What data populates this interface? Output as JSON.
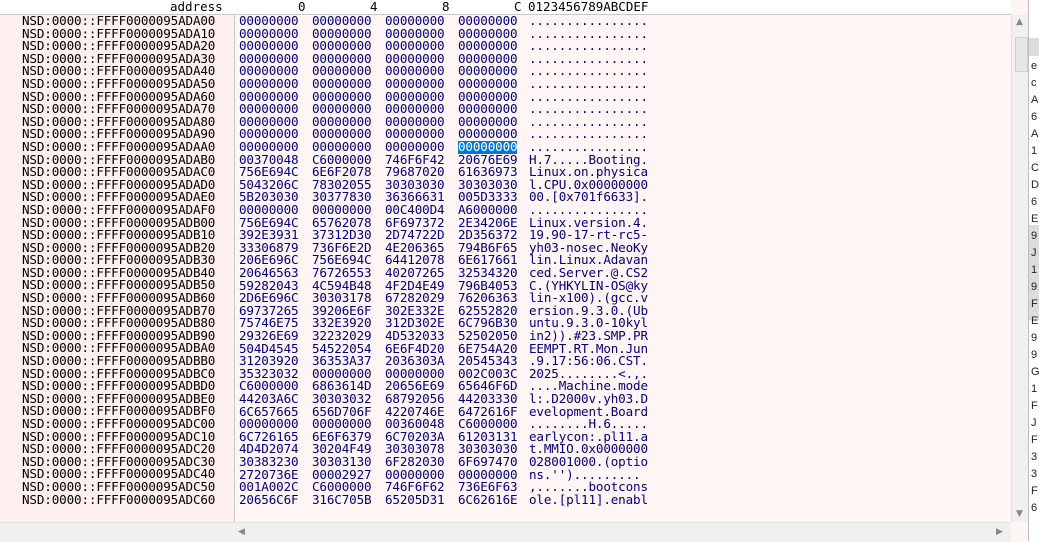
{
  "header": {
    "address": "address",
    "col0": "0",
    "col4": "4",
    "col8": "8",
    "colC": "C",
    "ascii": "0123456789ABCDEF"
  },
  "rows": [
    {
      "addr": "NSD:0000::FFFF0000095ADA00",
      "w": [
        "00000000",
        "00000000",
        "00000000",
        "00000000"
      ],
      "a": "................"
    },
    {
      "addr": "NSD:0000::FFFF0000095ADA10",
      "w": [
        "00000000",
        "00000000",
        "00000000",
        "00000000"
      ],
      "a": "................"
    },
    {
      "addr": "NSD:0000::FFFF0000095ADA20",
      "w": [
        "00000000",
        "00000000",
        "00000000",
        "00000000"
      ],
      "a": "................"
    },
    {
      "addr": "NSD:0000::FFFF0000095ADA30",
      "w": [
        "00000000",
        "00000000",
        "00000000",
        "00000000"
      ],
      "a": "................"
    },
    {
      "addr": "NSD:0000::FFFF0000095ADA40",
      "w": [
        "00000000",
        "00000000",
        "00000000",
        "00000000"
      ],
      "a": "................"
    },
    {
      "addr": "NSD:0000::FFFF0000095ADA50",
      "w": [
        "00000000",
        "00000000",
        "00000000",
        "00000000"
      ],
      "a": "................"
    },
    {
      "addr": "NSD:0000::FFFF0000095ADA60",
      "w": [
        "00000000",
        "00000000",
        "00000000",
        "00000000"
      ],
      "a": "................"
    },
    {
      "addr": "NSD:0000::FFFF0000095ADA70",
      "w": [
        "00000000",
        "00000000",
        "00000000",
        "00000000"
      ],
      "a": "................"
    },
    {
      "addr": "NSD:0000::FFFF0000095ADA80",
      "w": [
        "00000000",
        "00000000",
        "00000000",
        "00000000"
      ],
      "a": "................"
    },
    {
      "addr": "NSD:0000::FFFF0000095ADA90",
      "w": [
        "00000000",
        "00000000",
        "00000000",
        "00000000"
      ],
      "a": "................"
    },
    {
      "addr": "NSD:0000::FFFF0000095ADAA0",
      "w": [
        "00000000",
        "00000000",
        "00000000",
        "00000000"
      ],
      "a": "................"
    },
    {
      "addr": "NSD:0000::FFFF0000095ADAB0",
      "w": [
        "00370048",
        "C6000000",
        "746F6F42",
        "20676E69"
      ],
      "a": "H.7.....Booting."
    },
    {
      "addr": "NSD:0000::FFFF0000095ADAC0",
      "w": [
        "756E694C",
        "6E6F2078",
        "79687020",
        "61636973"
      ],
      "a": "Linux.on.physica"
    },
    {
      "addr": "NSD:0000::FFFF0000095ADAD0",
      "w": [
        "5043206C",
        "78302055",
        "30303030",
        "30303030"
      ],
      "a": "l.CPU.0x00000000"
    },
    {
      "addr": "NSD:0000::FFFF0000095ADAE0",
      "w": [
        "5B203030",
        "30377830",
        "36366631",
        "005D3333"
      ],
      "a": "00.[0x701f6633]."
    },
    {
      "addr": "NSD:0000::FFFF0000095ADAF0",
      "w": [
        "00000000",
        "00000000",
        "00C400D4",
        "A6000000"
      ],
      "a": "................"
    },
    {
      "addr": "NSD:0000::FFFF0000095ADB00",
      "w": [
        "756E694C",
        "65762078",
        "6F697372",
        "2E34206E"
      ],
      "a": "Linux.version.4."
    },
    {
      "addr": "NSD:0000::FFFF0000095ADB10",
      "w": [
        "392E3931",
        "37312D30",
        "2D74722D",
        "2D356372"
      ],
      "a": "19.90-17-rt-rc5-"
    },
    {
      "addr": "NSD:0000::FFFF0000095ADB20",
      "w": [
        "33306879",
        "736F6E2D",
        "4E206365",
        "794B6F65"
      ],
      "a": "yh03-nosec.NeoKy"
    },
    {
      "addr": "NSD:0000::FFFF0000095ADB30",
      "w": [
        "206E696C",
        "756E694C",
        "64412078",
        "6E617661"
      ],
      "a": "lin.Linux.Adavan"
    },
    {
      "addr": "NSD:0000::FFFF0000095ADB40",
      "w": [
        "20646563",
        "76726553",
        "40207265",
        "32534320"
      ],
      "a": "ced.Server.@.CS2"
    },
    {
      "addr": "NSD:0000::FFFF0000095ADB50",
      "w": [
        "59282043",
        "4C594B48",
        "4F2D4E49",
        "796B4053"
      ],
      "a": "C.(YHKYLIN-OS@ky"
    },
    {
      "addr": "NSD:0000::FFFF0000095ADB60",
      "w": [
        "2D6E696C",
        "30303178",
        "67282029",
        "76206363"
      ],
      "a": "lin-x100).(gcc.v"
    },
    {
      "addr": "NSD:0000::FFFF0000095ADB70",
      "w": [
        "69737265",
        "39206E6F",
        "302E332E",
        "62552820"
      ],
      "a": "ersion.9.3.0.(Ub"
    },
    {
      "addr": "NSD:0000::FFFF0000095ADB80",
      "w": [
        "75746E75",
        "332E3920",
        "312D302E",
        "6C796B30"
      ],
      "a": "untu.9.3.0-10kyl"
    },
    {
      "addr": "NSD:0000::FFFF0000095ADB90",
      "w": [
        "29326E69",
        "32232029",
        "4D532033",
        "52502050"
      ],
      "a": "in2)).#23.SMP.PR"
    },
    {
      "addr": "NSD:0000::FFFF0000095ADBA0",
      "w": [
        "504D4545",
        "54522054",
        "6E6F4D20",
        "6E754A20"
      ],
      "a": "EEMPT.RT.Mon.Jun"
    },
    {
      "addr": "NSD:0000::FFFF0000095ADBB0",
      "w": [
        "31203920",
        "36353A37",
        "2036303A",
        "20545343"
      ],
      "a": ".9.17:56:06.CST."
    },
    {
      "addr": "NSD:0000::FFFF0000095ADBC0",
      "w": [
        "35323032",
        "00000000",
        "00000000",
        "002C003C"
      ],
      "a": "2025........<.,."
    },
    {
      "addr": "NSD:0000::FFFF0000095ADBD0",
      "w": [
        "C6000000",
        "6863614D",
        "20656E69",
        "65646F6D"
      ],
      "a": "....Machine.mode"
    },
    {
      "addr": "NSD:0000::FFFF0000095ADBE0",
      "w": [
        "44203A6C",
        "30303032",
        "68792056",
        "44203330"
      ],
      "a": "l:.D2000v.yh03.D"
    },
    {
      "addr": "NSD:0000::FFFF0000095ADBF0",
      "w": [
        "6C657665",
        "656D706F",
        "4220746E",
        "6472616F"
      ],
      "a": "evelopment.Board"
    },
    {
      "addr": "NSD:0000::FFFF0000095ADC00",
      "w": [
        "00000000",
        "00000000",
        "00360048",
        "C6000000"
      ],
      "a": "........H.6....."
    },
    {
      "addr": "NSD:0000::FFFF0000095ADC10",
      "w": [
        "6C726165",
        "6E6F6379",
        "6C70203A",
        "61203131"
      ],
      "a": "earlycon:.pl11.a"
    },
    {
      "addr": "NSD:0000::FFFF0000095ADC20",
      "w": [
        "4D4D2074",
        "30204F49",
        "30303078",
        "30303030"
      ],
      "a": "t.MMIO.0x0000000"
    },
    {
      "addr": "NSD:0000::FFFF0000095ADC30",
      "w": [
        "30383230",
        "30303130",
        "6F282030",
        "6F697470"
      ],
      "a": "028001000.(optio"
    },
    {
      "addr": "NSD:0000::FFFF0000095ADC40",
      "w": [
        "2720736E",
        "00002927",
        "00000000",
        "00000000"
      ],
      "a": "ns.'')........."
    },
    {
      "addr": "NSD:0000::FFFF0000095ADC50",
      "w": [
        "001A002C",
        "C6000000",
        "746F6F62",
        "736E6F63"
      ],
      "a": ",.......bootcons"
    },
    {
      "addr": "NSD:0000::FFFF0000095ADC60",
      "w": [
        "20656C6F",
        "316C705B",
        "65205D31",
        "6C62616E"
      ],
      "a": "ole.[pl11].enabl"
    }
  ],
  "selection": {
    "row": 10,
    "word": 3
  },
  "right_strip_glyphs": [
    "e",
    "c",
    "A",
    "6",
    "A",
    "1",
    "C",
    "D",
    "6",
    "E",
    "9",
    "J",
    "1",
    "9",
    "F",
    "E",
    "9",
    "9",
    "G",
    "1",
    "F",
    "J",
    "F",
    "3",
    "3",
    "F",
    "6"
  ]
}
